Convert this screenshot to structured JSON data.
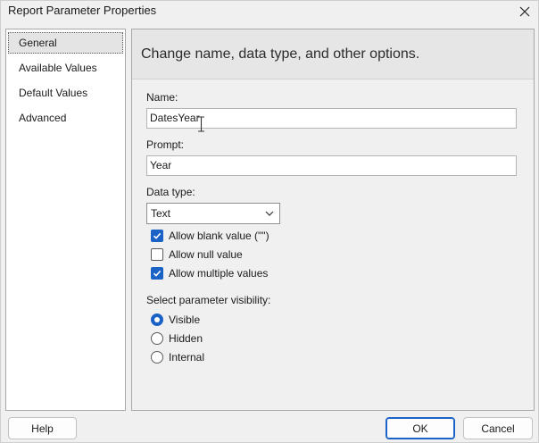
{
  "window": {
    "title": "Report Parameter Properties"
  },
  "nav": {
    "items": [
      {
        "label": "General"
      },
      {
        "label": "Available Values"
      },
      {
        "label": "Default Values"
      },
      {
        "label": "Advanced"
      }
    ],
    "selected": "General"
  },
  "header": {
    "text": "Change name, data type, and other options."
  },
  "form": {
    "name_label": "Name:",
    "name_value": "DatesYear",
    "prompt_label": "Prompt:",
    "prompt_value": "Year",
    "datatype_label": "Data type:",
    "datatype_value": "Text",
    "checkboxes": [
      {
        "label": "Allow blank value (\"\")",
        "checked": true
      },
      {
        "label": "Allow null value",
        "checked": false
      },
      {
        "label": "Allow multiple values",
        "checked": true
      }
    ],
    "visibility_label": "Select parameter visibility:",
    "radios": [
      {
        "label": "Visible",
        "checked": true
      },
      {
        "label": "Hidden",
        "checked": false
      },
      {
        "label": "Internal",
        "checked": false
      }
    ]
  },
  "buttons": {
    "help": "Help",
    "ok": "OK",
    "cancel": "Cancel"
  },
  "colors": {
    "accent": "#1a62c6",
    "background": "#f0f0f0",
    "header_band": "#e6e6e6"
  }
}
